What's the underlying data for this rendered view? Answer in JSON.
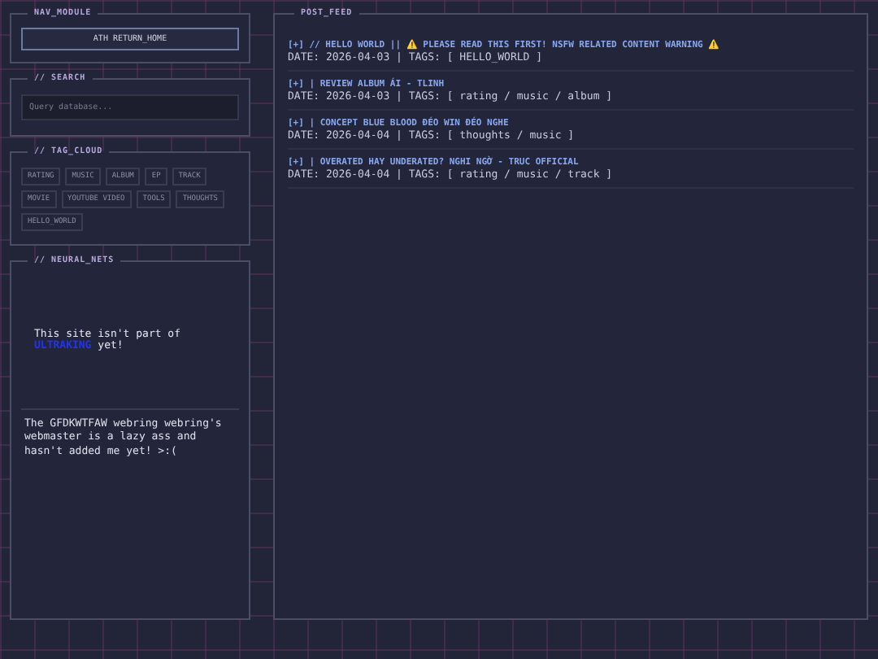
{
  "sidebar": {
    "nav": {
      "title": "NAV_MODULE",
      "button": "ATH RETURN_HOME"
    },
    "search": {
      "title": "// SEARCH",
      "placeholder": "Query database..."
    },
    "tag_cloud": {
      "title": "// TAG_CLOUD",
      "tags": [
        "RATING",
        "MUSIC",
        "ALBUM",
        "EP",
        "TRACK",
        "MOVIE",
        "YOUTUBE VIDEO",
        "TOOLS",
        "THOUGHTS",
        "HELLO_WORLD"
      ]
    },
    "neural_nets": {
      "title": "// NEURAL_NETS",
      "notice": "This site isn't part of",
      "link": "ULTRAKING",
      "notice_end": "yet!",
      "webring": "The GFDKWTFAW webring webring's webmaster is a lazy ass and hasn't added me yet! >:("
    }
  },
  "post_feed": {
    "title": "POST_FEED",
    "posts": [
      {
        "title": "[+] // HELLO WORLD || ⚠️ PLEASE READ THIS FIRST! NSFW RELATED CONTENT WARNING ⚠️",
        "meta": "DATE: 2026-04-03 | TAGS: [ HELLO_WORLD ]"
      },
      {
        "title": "[+] | REVIEW ALBUM ÁI - TLINH",
        "meta": "DATE: 2026-04-03 | TAGS: [ rating / music / album ]"
      },
      {
        "title": "[+] | CONCEPT BLUE BLOOD ĐÉO WIN ĐÉO NGHE",
        "meta": "DATE: 2026-04-04 | TAGS: [ thoughts / music ]"
      },
      {
        "title": "[+] | OVERATED HAY UNDERATED? NGHI NGỜ - TRUC OFFICIAL",
        "meta": "DATE: 2026-04-04 | TAGS: [ rating / music / track ]"
      }
    ]
  }
}
